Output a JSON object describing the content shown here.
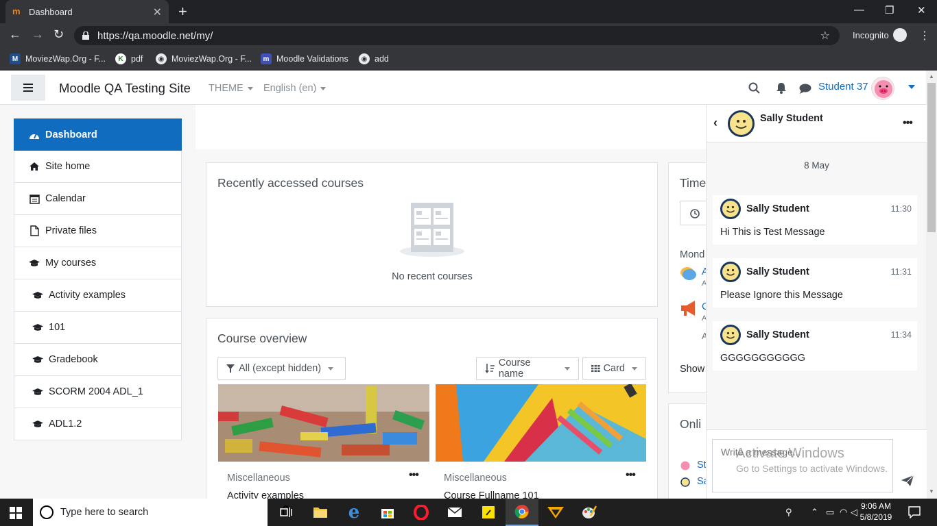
{
  "browser": {
    "tab_title": "Dashboard",
    "url": "https://qa.moodle.net/my/",
    "incognito_label": "Incognito",
    "bookmarks": [
      {
        "label": "MoviezWap.Org - F..."
      },
      {
        "label": "pdf"
      },
      {
        "label": "MoviezWap.Org - F..."
      },
      {
        "label": "Moodle Validations"
      },
      {
        "label": "add"
      }
    ]
  },
  "navbar": {
    "site_name": "Moodle QA Testing Site",
    "theme_label": "THEME",
    "language_label": "English (en)",
    "user_name": "Student 37"
  },
  "drawer": {
    "items": [
      {
        "label": "Dashboard",
        "icon": "dashboard-icon"
      },
      {
        "label": "Site home",
        "icon": "home-icon"
      },
      {
        "label": "Calendar",
        "icon": "calendar-icon"
      },
      {
        "label": "Private files",
        "icon": "file-icon"
      },
      {
        "label": "My courses",
        "icon": "graduation-cap-icon"
      },
      {
        "label": "Activity examples",
        "icon": "graduation-cap-icon"
      },
      {
        "label": "101",
        "icon": "graduation-cap-icon"
      },
      {
        "label": "Gradebook",
        "icon": "graduation-cap-icon"
      },
      {
        "label": "SCORM 2004 ADL_1",
        "icon": "graduation-cap-icon"
      },
      {
        "label": "ADL1.2",
        "icon": "graduation-cap-icon"
      }
    ]
  },
  "recent_courses": {
    "title": "Recently accessed courses",
    "empty_text": "No recent courses"
  },
  "course_overview": {
    "title": "Course overview",
    "filter_label": "All (except hidden)",
    "sort_label": "Course name",
    "view_label": "Card",
    "courses": [
      {
        "category": "Miscellaneous",
        "name": "Activity examples"
      },
      {
        "category": "Miscellaneous",
        "name": "Course Fullname 101"
      }
    ]
  },
  "timeline": {
    "title": "Time",
    "day_label": "Mond",
    "item1": "A",
    "item2": "C",
    "show_label": "Show"
  },
  "online_users": {
    "title": "Onli",
    "user1": "St",
    "user2": "Sa"
  },
  "messages": {
    "contact_name": "Sally Student",
    "date_label": "8 May",
    "items": [
      {
        "sender": "Sally Student",
        "time": "11:30",
        "text": "Hi This is Test Message"
      },
      {
        "sender": "Sally Student",
        "time": "11:31",
        "text": "Please Ignore this Message"
      },
      {
        "sender": "Sally Student",
        "time": "11:34",
        "text": "GGGGGGGGGGG"
      }
    ],
    "input_placeholder": "Write a message..."
  },
  "watermark": {
    "line1": "Activate Windows",
    "line2": "Go to Settings to activate Windows."
  },
  "taskbar": {
    "search_placeholder": "Type here to search",
    "time": "9:06 AM",
    "date": "5/8/2019"
  },
  "colors": {
    "brand_blue": "#0f6cbf",
    "moodle_orange": "#f98012"
  }
}
